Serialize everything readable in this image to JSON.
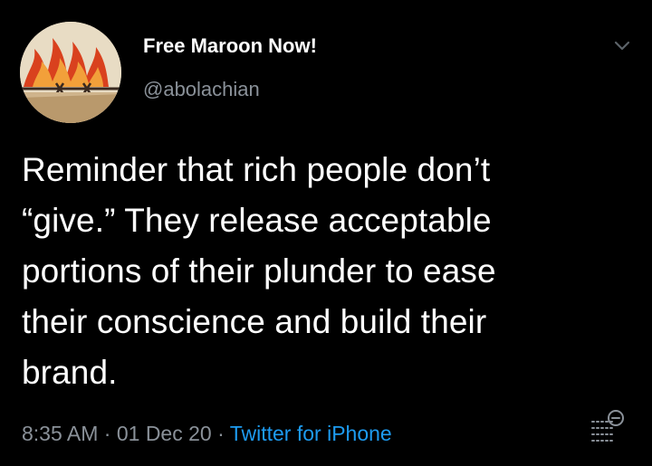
{
  "tweet": {
    "display_name": "Free Maroon Now!",
    "handle": "@abolachian",
    "text_lines": [
      "Reminder that rich people don’t",
      "“give.” They release acceptable",
      "portions of their plunder to ease",
      "their conscience and build their",
      "brand."
    ],
    "time": "8:35 AM",
    "separator": " · ",
    "date": "01 Dec 20",
    "source": "Twitter for iPhone"
  },
  "icons": {
    "avatar": "flame-barbed-wire-avatar",
    "menu": "chevron-down-icon",
    "analytics": "analytics-icon"
  },
  "colors": {
    "background": "#000000",
    "primary_text": "#ffffff",
    "secondary_text": "#8a9199",
    "link": "#1d9bf0"
  }
}
